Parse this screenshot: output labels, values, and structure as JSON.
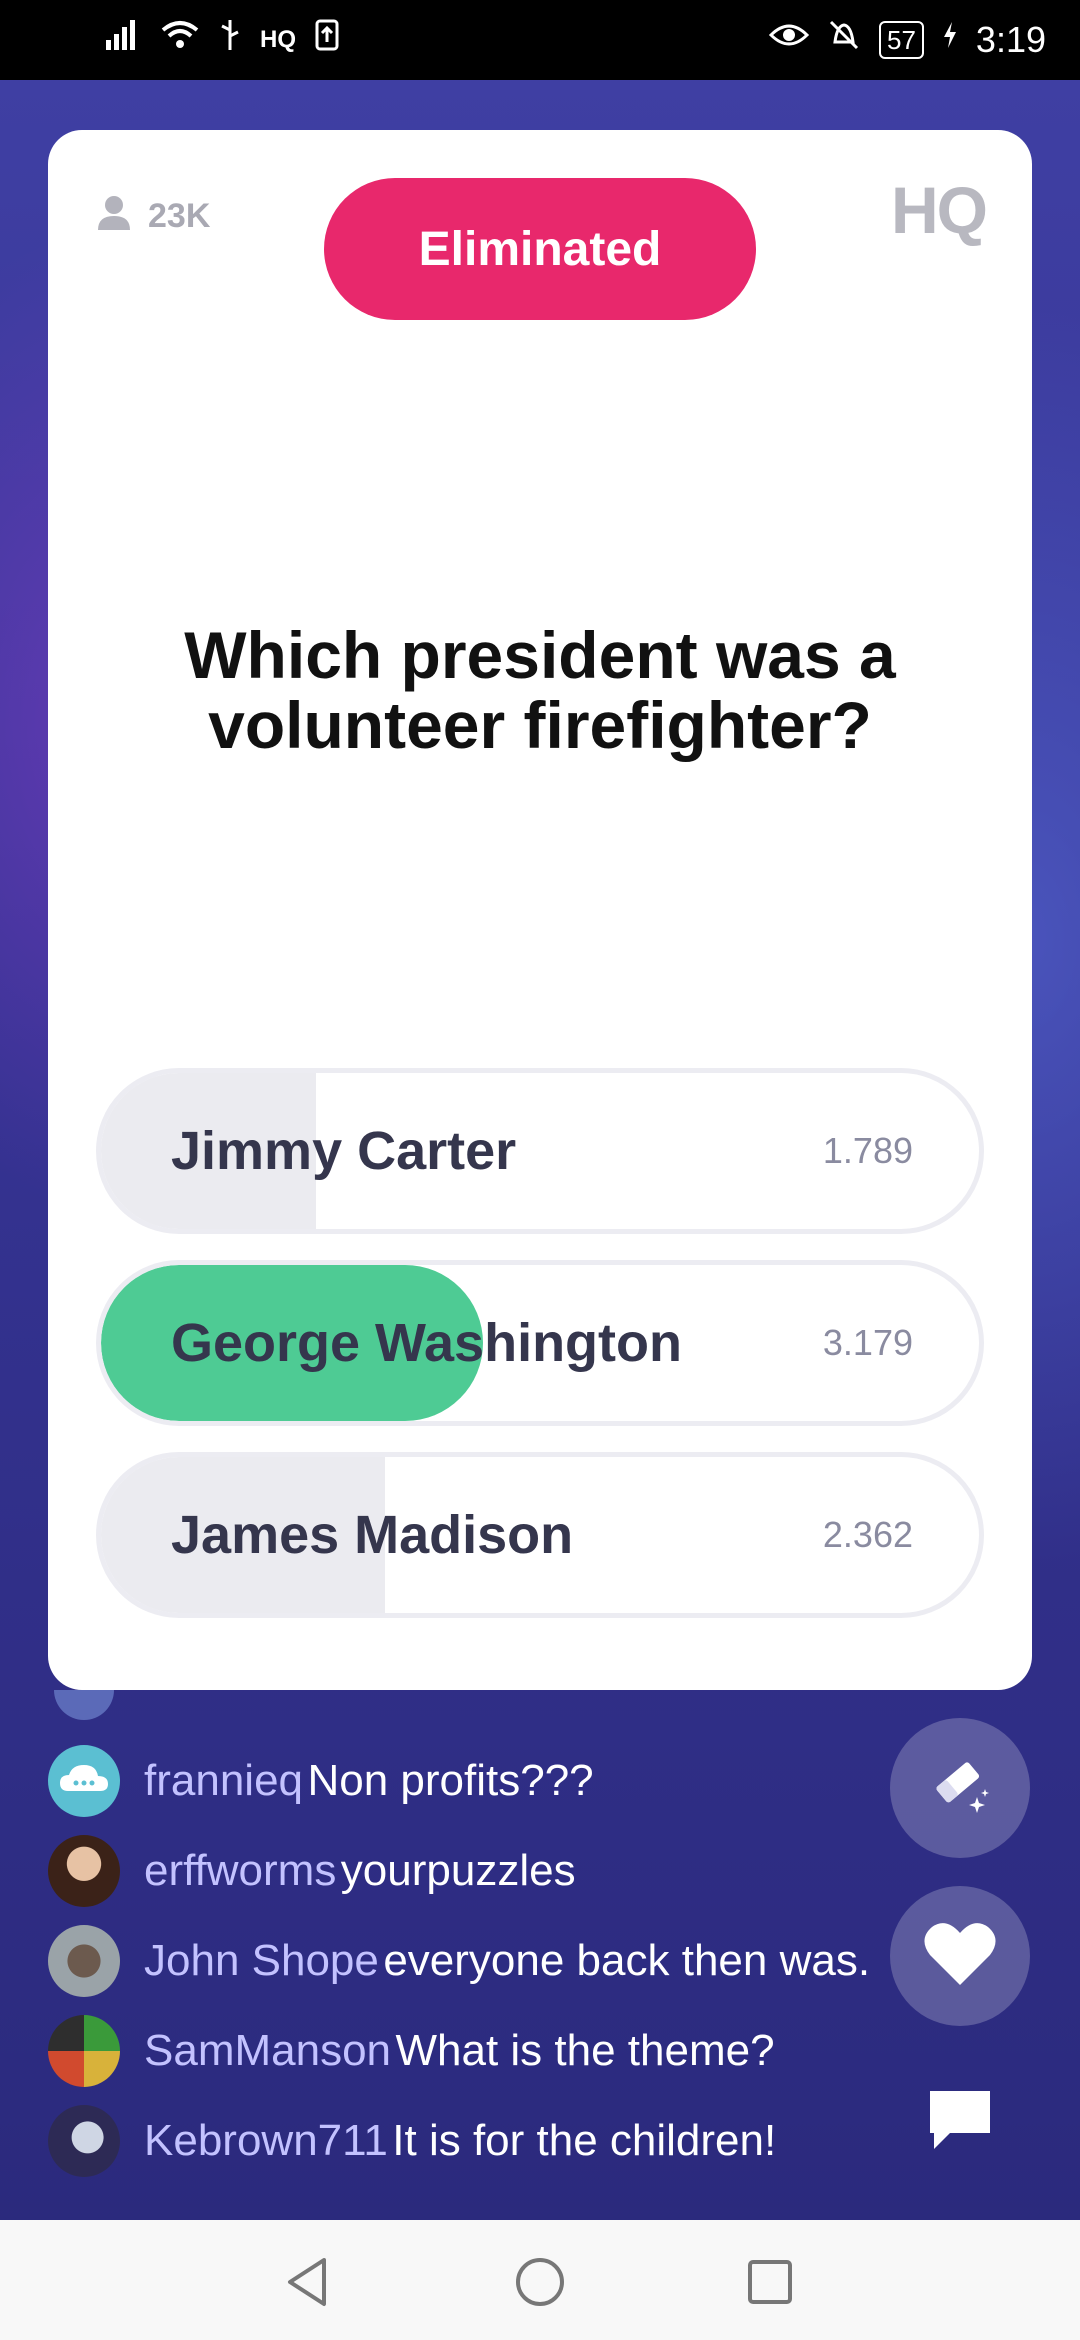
{
  "status_bar": {
    "carrier_tag": "HQ",
    "battery": "57",
    "time": "3:19"
  },
  "card": {
    "viewer_count": "23K",
    "status_badge": "Eliminated",
    "logo": "HQ",
    "question": "Which president was a volunteer firefighter?",
    "answers": [
      {
        "label": "Jimmy Carter",
        "count": "1.789",
        "share": 0.245,
        "correct": false
      },
      {
        "label": "George Washington",
        "count": "3.179",
        "share": 0.435,
        "correct": true
      },
      {
        "label": "James Madison",
        "count": "2.362",
        "share": 0.323,
        "correct": false
      }
    ]
  },
  "chat": [
    {
      "user": "frannieq",
      "message": "Non profits???",
      "avatar": "cloud-avatar"
    },
    {
      "user": "erffworms",
      "message": "yourpuzzles",
      "avatar": "photo-avatar"
    },
    {
      "user": "John Shope",
      "message": "everyone back then was.",
      "avatar": "photo-avatar"
    },
    {
      "user": "SamManson",
      "message": "What is the theme?",
      "avatar": "photo-avatar"
    },
    {
      "user": "Kebrown711",
      "message": "It is for the children!",
      "avatar": "photo-avatar"
    }
  ],
  "buttons": {
    "eraser": "eraser-icon",
    "heart": "heart-icon",
    "chat": "chat-bubble-icon"
  },
  "colors": {
    "eliminated": "#e8286c",
    "correct": "#4ecb94",
    "chat_user": "#c3c2ff",
    "background": "#353392"
  }
}
